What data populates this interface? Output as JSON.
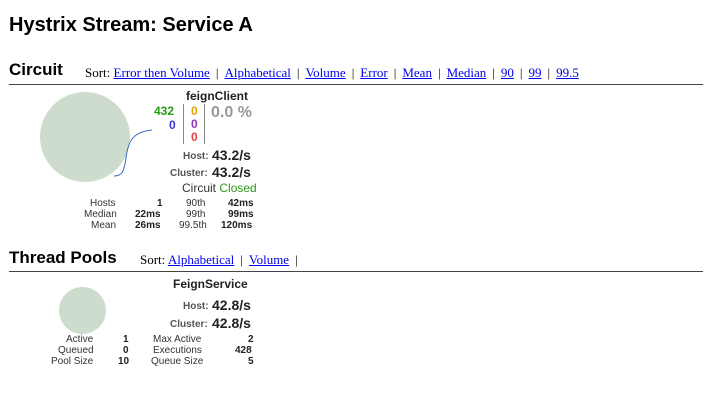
{
  "page": {
    "title": "Hystrix Stream: Service A"
  },
  "circuit": {
    "heading": "Circuit",
    "sort_label": "Sort:",
    "sort_links": [
      "Error then Volume",
      "Alphabetical",
      "Volume",
      "Error",
      "Mean",
      "Median",
      "90",
      "99",
      "99.5"
    ],
    "card": {
      "name": "feignClient",
      "success": "432",
      "short_circuited": "0",
      "bad_request": "0",
      "timeout": "0",
      "rejected": "0",
      "failure": "0",
      "error_pct": "0.0 %",
      "host_label": "Host:",
      "host_rate": "43.2/s",
      "cluster_label": "Cluster:",
      "cluster_rate": "43.2/s",
      "circuit_label": "Circuit",
      "circuit_status": "Closed",
      "hosts_label": "Hosts",
      "hosts_value": "1",
      "median_label": "Median",
      "median_value": "22ms",
      "mean_label": "Mean",
      "mean_value": "26ms",
      "p90_label": "90th",
      "p90_value": "42ms",
      "p99_label": "99th",
      "p99_value": "99ms",
      "p995_label": "99.5th",
      "p995_value": "120ms",
      "colors": {
        "circle": "#cddccd",
        "success": "#2e9a1c",
        "closed": "#2e9a1c"
      }
    }
  },
  "threadpools": {
    "heading": "Thread Pools",
    "sort_label": "Sort:",
    "sort_links": [
      "Alphabetical",
      "Volume"
    ],
    "card": {
      "name": "FeignService",
      "host_label": "Host:",
      "host_rate": "42.8/s",
      "cluster_label": "Cluster:",
      "cluster_rate": "42.8/s",
      "active_label": "Active",
      "active_value": "1",
      "queued_label": "Queued",
      "queued_value": "0",
      "poolsize_label": "Pool Size",
      "poolsize_value": "10",
      "maxactive_label": "Max Active",
      "maxactive_value": "2",
      "executions_label": "Executions",
      "executions_value": "428",
      "queuesize_label": "Queue Size",
      "queuesize_value": "5"
    }
  }
}
